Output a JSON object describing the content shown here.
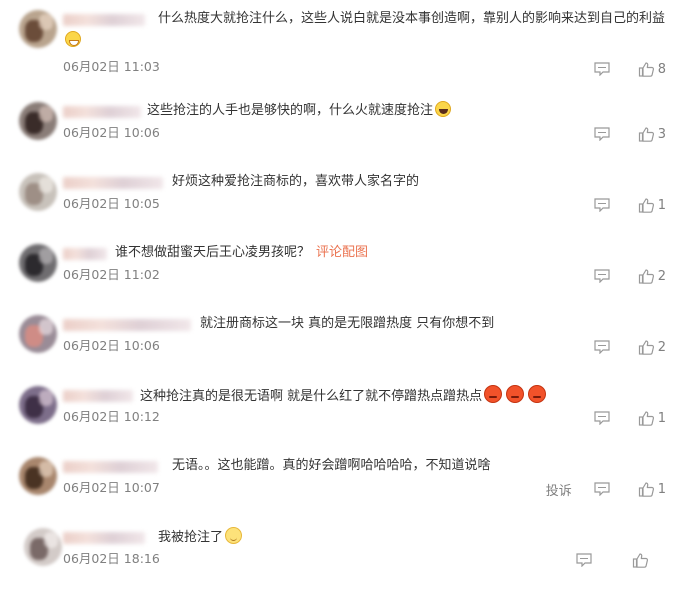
{
  "comments": [
    {
      "text": "什么热度大就抢注什么，这些人说白就是没本事创造啊，靠别人的影响来达到自己的利益",
      "emoji": "grin",
      "time": "06月02日 11:03",
      "likes": "8",
      "report": ""
    },
    {
      "text": "这些抢注的人手也是够快的啊，什么火就速度抢注",
      "emoji": "laugh",
      "time": "06月02日 10:06",
      "likes": "3",
      "report": ""
    },
    {
      "text": "好烦这种爱抢注商标的，喜欢带人家名字的",
      "emoji": "",
      "time": "06月02日 10:05",
      "likes": "1",
      "report": ""
    },
    {
      "text": "谁不想做甜蜜天后王心凌男孩呢？",
      "link": "评论配图",
      "emoji": "",
      "time": "06月02日 11:02",
      "likes": "2",
      "report": ""
    },
    {
      "text": "就注册商标这一块 真的是无限蹭热度 只有你想不到",
      "emoji": "",
      "time": "06月02日 10:06",
      "likes": "2",
      "report": ""
    },
    {
      "text": "这种抢注真的是很无语啊 就是什么红了就不停蹭热点蹭热点",
      "emoji": "angry3",
      "time": "06月02日 10:12",
      "likes": "1",
      "report": ""
    },
    {
      "text": "无语。。这也能蹭。真的好会蹭啊哈哈哈哈，不知道说啥",
      "emoji": "",
      "time": "06月02日 10:07",
      "likes": "1",
      "report": "投诉"
    },
    {
      "text": "我被抢注了",
      "emoji": "smile",
      "time": "06月02日 18:16",
      "likes": "",
      "report": ""
    }
  ],
  "icons": {
    "comment": "comment-icon",
    "like": "thumbs-up-icon"
  },
  "colors": {
    "text": "#333333",
    "meta": "#808080",
    "link": "#eb7350"
  }
}
